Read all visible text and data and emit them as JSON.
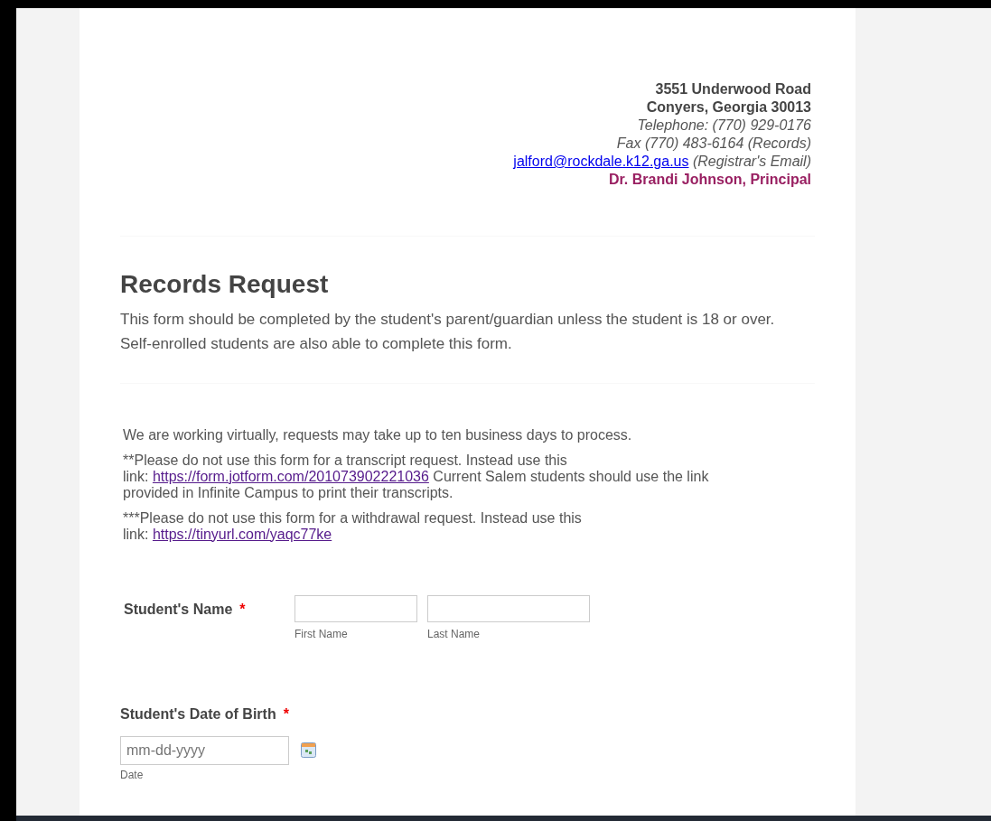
{
  "address": [
    {
      "text": "3551 Underwood Road",
      "kind": "bold"
    },
    {
      "text": "Conyers, Georgia 30013",
      "kind": "bold"
    },
    {
      "text": "Telephone: (770) 929-0176",
      "kind": "italic"
    },
    {
      "text": "Fax (770) 483-6164 (Records)",
      "kind": "italic"
    },
    {
      "text": "(Registrar's Email)",
      "kind": "email",
      "link": "jalford@rockdale.k12.ga.us"
    },
    {
      "text": "Dr. Brandi Johnson, Principal",
      "kind": "principal"
    }
  ],
  "heading": "Records Request",
  "description": "This form should be completed by the student's parent/guardian unless the student is 18 or over. Self-enrolled students are also able to complete this form.",
  "notes": [
    {
      "before": "We are working virtually, requests may take up to ten business days to process."
    },
    {
      "before": "**Please do not use this form for a transcript request.  Instead use this\nlink: ",
      "link": "https://form.jotform.com/201073902221036",
      "after": "  Current Salem students should use the link\nprovided in Infinite Campus to print their transcripts."
    },
    {
      "before": "***Please do not use this form for a withdrawal request. Instead use this\nlink: ",
      "link": "https://tinyurl.com/yaqc77ke"
    }
  ],
  "fields": [
    {
      "kind": "name",
      "label": "Student's Name",
      "required": true,
      "required_mark": "*",
      "inputs": [
        {
          "sublabel": "First Name"
        },
        {
          "sublabel": "Last Name"
        }
      ]
    },
    {
      "kind": "date",
      "label": "Student's Date of Birth",
      "required": true,
      "required_mark": "*",
      "placeholder": "mm-dd-yyyy",
      "sublabel": "Date"
    }
  ]
}
